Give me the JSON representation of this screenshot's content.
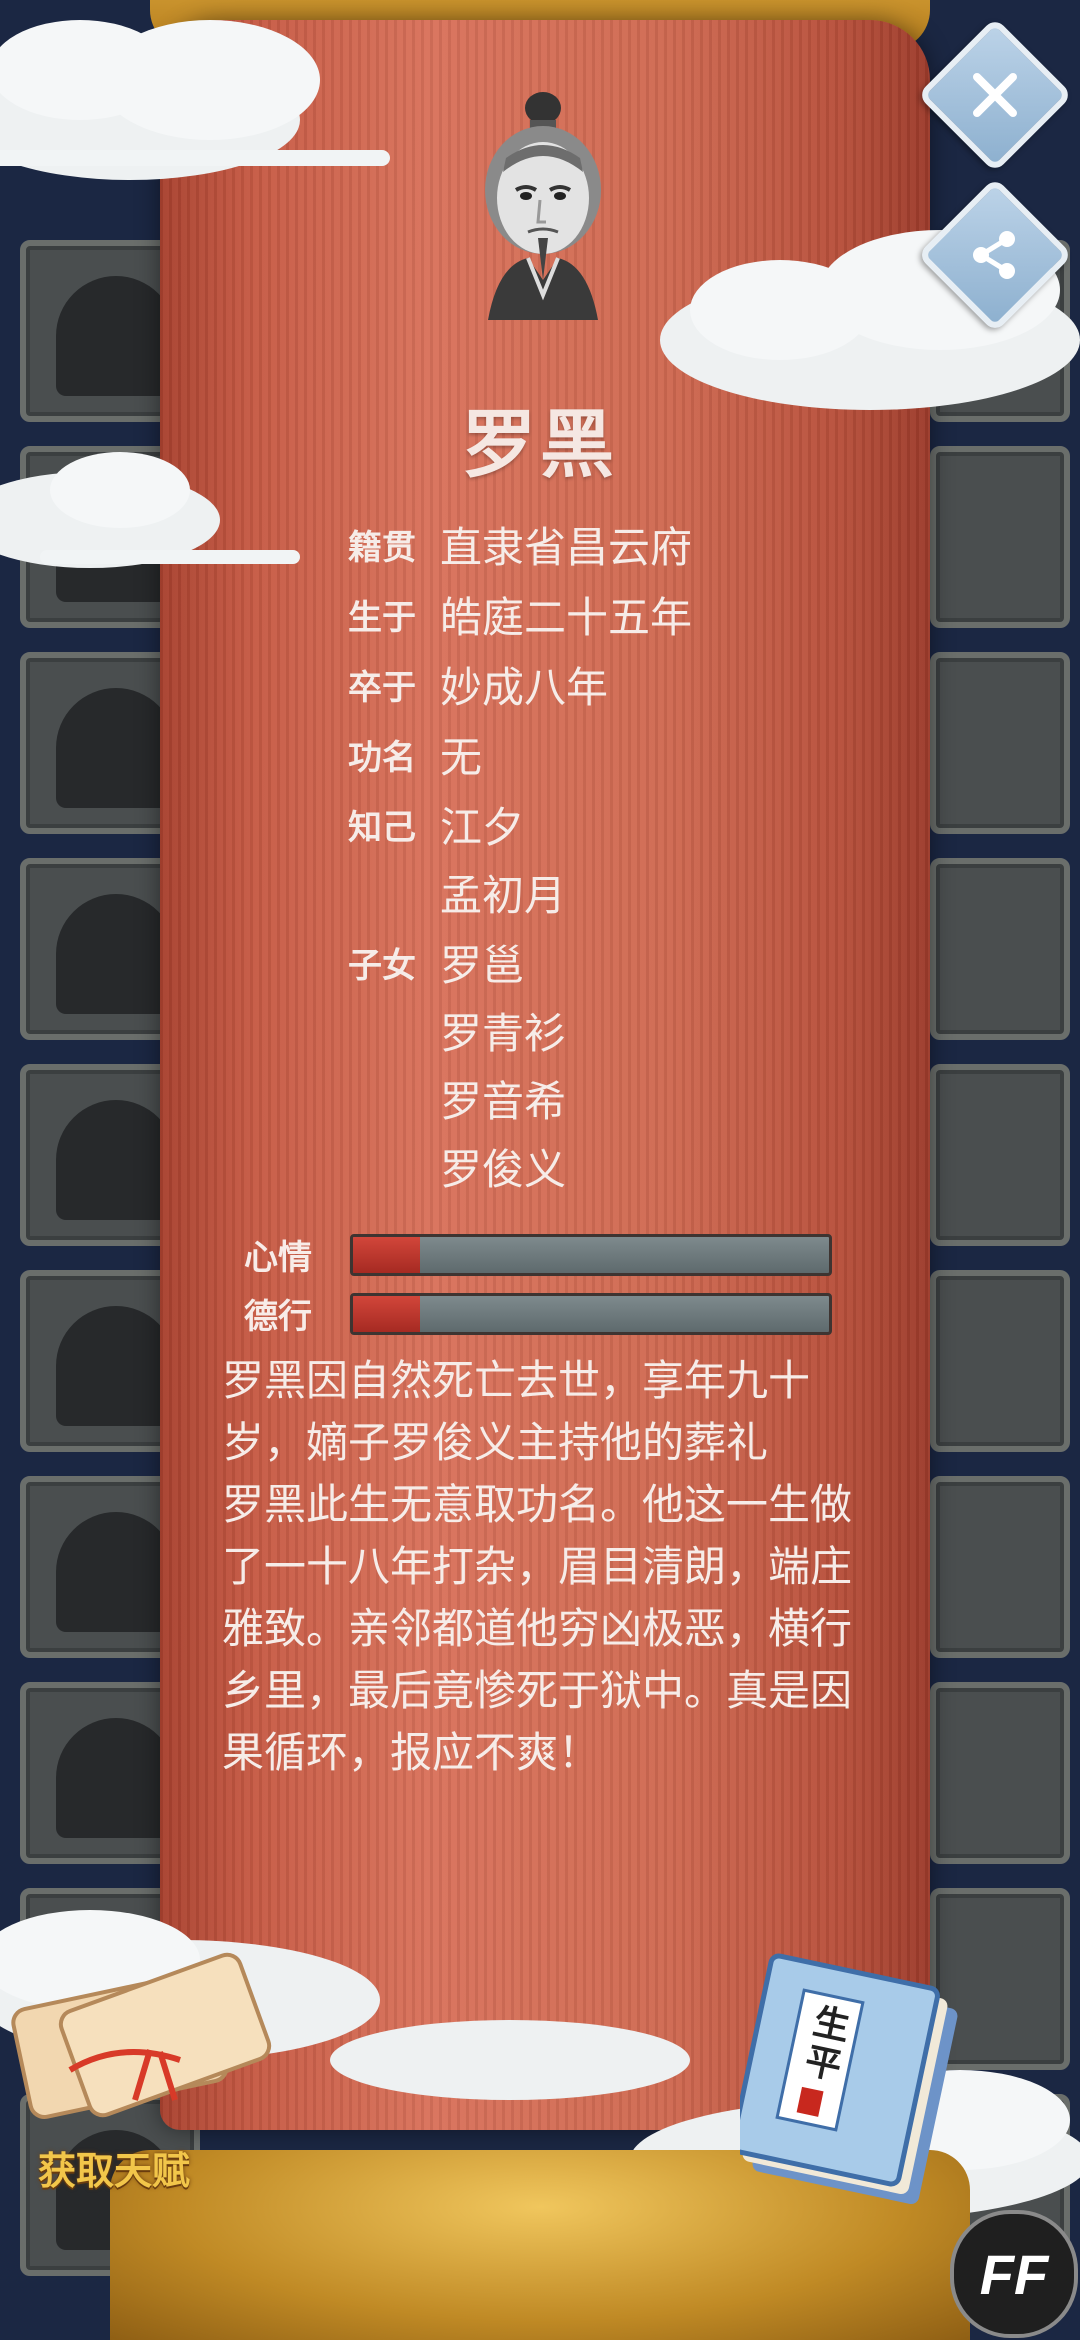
{
  "character": {
    "name": "罗黑"
  },
  "info": {
    "origin_label": "籍贯",
    "origin_value": "直隶省昌云府",
    "born_label": "生于",
    "born_value": "皓庭二十五年",
    "died_label": "卒于",
    "died_value": "妙成八年",
    "rank_label": "功名",
    "rank_value": "无",
    "confidants_label": "知己",
    "confidants": [
      "江夕",
      "孟初月"
    ],
    "children_label": "子女",
    "children": [
      "罗邕",
      "罗青衫",
      "罗音希",
      "罗俊义"
    ]
  },
  "stats": {
    "mood_label": "心情",
    "mood_level": 0.14,
    "virtue_label": "德行",
    "virtue_level": 0.14
  },
  "narrative": {
    "paragraph1": "罗黑因自然死亡去世，享年九十岁，嫡子罗俊义主持他的葬礼",
    "paragraph2": "罗黑此生无意取功名。他这一生做了一十八年打杂，眉目清朗，端庄雅致。亲邻都道他穷凶极恶，横行乡里，最后竟惨死于狱中。真是因果循环，报应不爽！"
  },
  "buttons": {
    "get_talent_label": "获取天赋",
    "ff_label": "FF"
  },
  "book": {
    "title": "生平"
  },
  "colors": {
    "scroll": "#c65a44",
    "text": "#f6ece8",
    "bar_fill": "#c23a2f",
    "bar_empty": "#6e7a7d",
    "talent_text": "#f2c64a"
  }
}
